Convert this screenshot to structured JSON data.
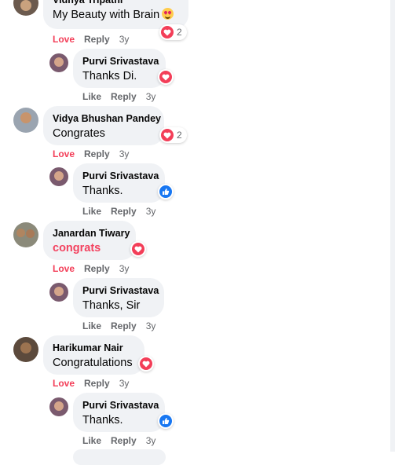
{
  "comments": [
    {
      "name": "Vidhya Tripathi",
      "text": "My Beauty with Brain",
      "emoji": "heart-eyes-emoji",
      "actions": [
        "Love",
        "Reply",
        "3y"
      ],
      "reaction": {
        "icon": "heart-icon",
        "count": "2"
      },
      "reply": {
        "name": "Purvi Srivastava",
        "text": "Thanks Di.",
        "actions": [
          "Like",
          "Reply",
          "3y"
        ],
        "reaction": {
          "icon": "heart-icon",
          "count": ""
        }
      }
    },
    {
      "name": "Vidya Bhushan Pandey",
      "text": "Congrates",
      "actions": [
        "Love",
        "Reply",
        "3y"
      ],
      "reaction": {
        "icon": "heart-icon",
        "count": "2"
      },
      "reply": {
        "name": "Purvi Srivastava",
        "text": "Thanks.",
        "actions": [
          "Like",
          "Reply",
          "3y"
        ],
        "reaction": {
          "icon": "like-icon",
          "count": ""
        }
      }
    },
    {
      "name": "Janardan Tiwary",
      "text": "congrats",
      "actions": [
        "Love",
        "Reply",
        "3y"
      ],
      "reaction": {
        "icon": "heart-icon",
        "count": ""
      },
      "reply": {
        "name": "Purvi Srivastava",
        "text": "Thanks, Sir",
        "actions": [
          "Like",
          "Reply",
          "3y"
        ],
        "reaction": null
      }
    },
    {
      "name": "Harikumar Nair",
      "text": "Congratulations",
      "actions": [
        "Love",
        "Reply",
        "3y"
      ],
      "reaction": {
        "icon": "heart-icon",
        "count": ""
      },
      "reply": {
        "name": "Purvi Srivastava",
        "text": "Thanks.",
        "actions": [
          "Like",
          "Reply",
          "3y"
        ],
        "reaction": {
          "icon": "like-icon",
          "count": ""
        }
      }
    }
  ],
  "colors": {
    "bubble": "#f0f2f5",
    "love": "#f33e58",
    "like": "#1877f2",
    "meta": "#65676b"
  }
}
